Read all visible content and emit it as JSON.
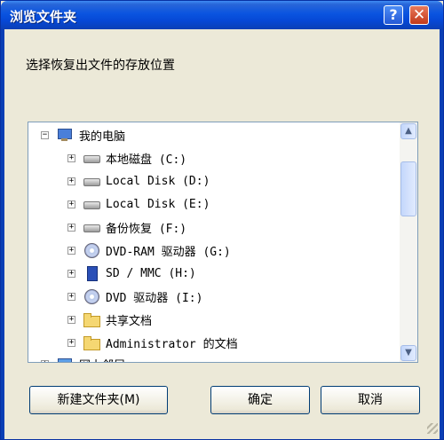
{
  "window": {
    "title": "浏览文件夹",
    "help_glyph": "?",
    "close_glyph": "✕"
  },
  "prompt": "选择恢复出文件的存放位置",
  "tree": {
    "items": [
      {
        "label": "我的电脑",
        "expander": "−",
        "icon": "computer-icon",
        "level": 0
      },
      {
        "label": "本地磁盘 (C:)",
        "expander": "+",
        "icon": "disk-icon",
        "level": 1
      },
      {
        "label": "Local Disk (D:)",
        "expander": "+",
        "icon": "disk-icon",
        "level": 1
      },
      {
        "label": "Local Disk (E:)",
        "expander": "+",
        "icon": "disk-icon",
        "level": 1
      },
      {
        "label": "备份恢复 (F:)",
        "expander": "+",
        "icon": "disk-icon",
        "level": 1
      },
      {
        "label": "DVD-RAM 驱动器 (G:)",
        "expander": "+",
        "icon": "cd-icon",
        "level": 1
      },
      {
        "label": "SD / MMC (H:)",
        "expander": "+",
        "icon": "sd-card-icon",
        "level": 1
      },
      {
        "label": "DVD 驱动器 (I:)",
        "expander": "+",
        "icon": "cd-icon",
        "level": 1
      },
      {
        "label": "共享文档",
        "expander": "+",
        "icon": "folder-icon",
        "level": 1
      },
      {
        "label": "Administrator 的文档",
        "expander": "+",
        "icon": "folder-icon",
        "level": 1
      },
      {
        "label": "网上邻居",
        "expander": "+",
        "icon": "network-icon",
        "level": 0
      }
    ]
  },
  "scrollbar": {
    "up_glyph": "▲",
    "down_glyph": "▼"
  },
  "buttons": {
    "new_folder": "新建文件夹(M)",
    "ok": "确定",
    "cancel": "取消"
  },
  "colors": {
    "titlebar": "#0a54e0",
    "dialog_bg": "#ece9d8",
    "tree_border": "#7f9db9"
  }
}
